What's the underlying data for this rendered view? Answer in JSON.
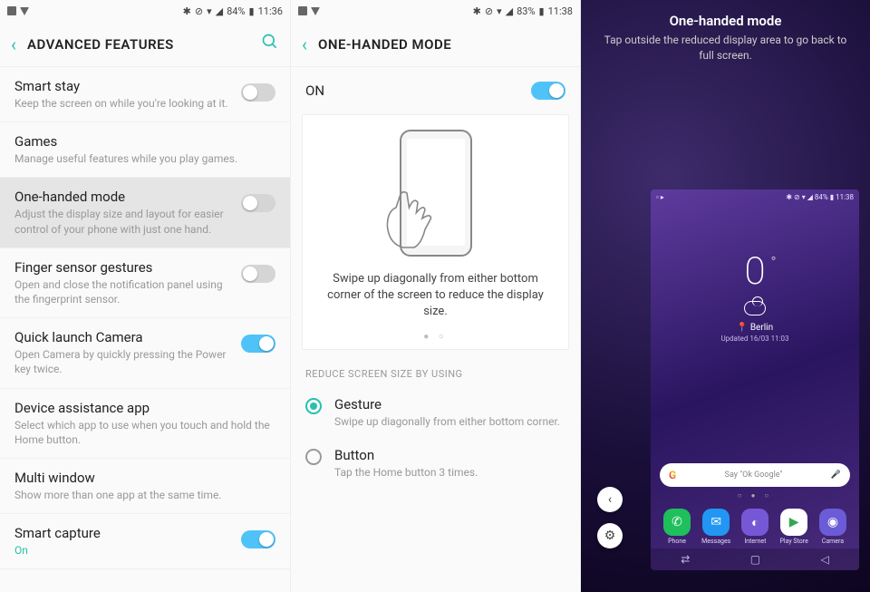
{
  "pane1": {
    "status": {
      "battery_pct": "84%",
      "time": "11:36"
    },
    "title": "ADVANCED FEATURES",
    "rows": [
      {
        "title": "Smart stay",
        "desc": "Keep the screen on while you're looking at it.",
        "toggle": "off"
      },
      {
        "title": "Games",
        "desc": "Manage useful features while you play games."
      },
      {
        "title": "One-handed mode",
        "desc": "Adjust the display size and layout for easier control of your phone with just one hand.",
        "toggle": "off",
        "selected": true
      },
      {
        "title": "Finger sensor gestures",
        "desc": "Open and close the notification panel using the fingerprint sensor.",
        "toggle": "off"
      },
      {
        "title": "Quick launch Camera",
        "desc": "Open Camera by quickly pressing the Power key twice.",
        "toggle": "on"
      },
      {
        "title": "Device assistance app",
        "desc": "Select which app to use when you touch and hold the Home button."
      },
      {
        "title": "Multi window",
        "desc": "Show more than one app at the same time."
      },
      {
        "title": "Smart capture",
        "desc": "On",
        "toggle": "on",
        "desc_on": true
      }
    ]
  },
  "pane2": {
    "status": {
      "battery_pct": "83%",
      "time": "11:38"
    },
    "title": "ONE-HANDED MODE",
    "on_label": "ON",
    "illus_text": "Swipe up diagonally from either bottom corner of the screen to reduce the display size.",
    "section": "REDUCE SCREEN SIZE BY USING",
    "options": [
      {
        "title": "Gesture",
        "desc": "Swipe up diagonally from either bottom corner.",
        "selected": true
      },
      {
        "title": "Button",
        "desc": "Tap the Home button 3 times.",
        "selected": false
      }
    ]
  },
  "pane3": {
    "title": "One-handed mode",
    "subtitle": "Tap outside the reduced display area to go back to full screen.",
    "mini": {
      "status": {
        "battery_pct": "84%",
        "time": "11:38"
      },
      "temp": "0",
      "city": "Berlin",
      "updated": "Updated 16/03 11:03",
      "search_hint": "Say \"Ok Google\"",
      "apps": [
        {
          "label": "Phone",
          "color": "#1fbf5c"
        },
        {
          "label": "Messages",
          "color": "#2196f3"
        },
        {
          "label": "Internet",
          "color": "#7658d6"
        },
        {
          "label": "Play Store",
          "color": "#ffffff"
        },
        {
          "label": "Camera",
          "color": "#6b5bd6"
        }
      ]
    }
  }
}
